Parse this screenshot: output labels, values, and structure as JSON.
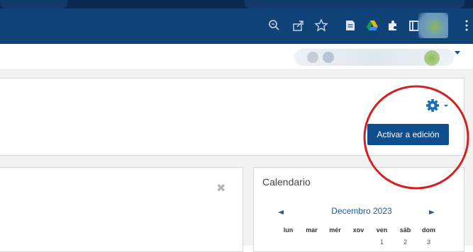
{
  "browser": {
    "toolbar_icons": [
      "zoom-icon",
      "share-icon",
      "bookmark-star-icon",
      "docs-extension-icon",
      "drive-extension-icon",
      "extensions-puzzle-icon",
      "sidebar-icon",
      "profile-avatar",
      "kebab-menu-icon"
    ],
    "accent": "#0f4377"
  },
  "header": {
    "settings_icon": "gear-icon",
    "edit_button_label": "Activar a edición"
  },
  "main": {
    "close_glyph": "✖"
  },
  "calendar": {
    "title": "Calendario",
    "month": "Decembro 2023",
    "weekdays": [
      "lun",
      "mar",
      "mér",
      "xov",
      "ven",
      "sáb",
      "dom"
    ],
    "dates_row1": [
      "",
      "",
      "",
      "",
      "1",
      "2",
      "3"
    ]
  },
  "colors": {
    "button": "#0f4e8c",
    "link": "#1f5a99",
    "annotation": "#d32020"
  }
}
